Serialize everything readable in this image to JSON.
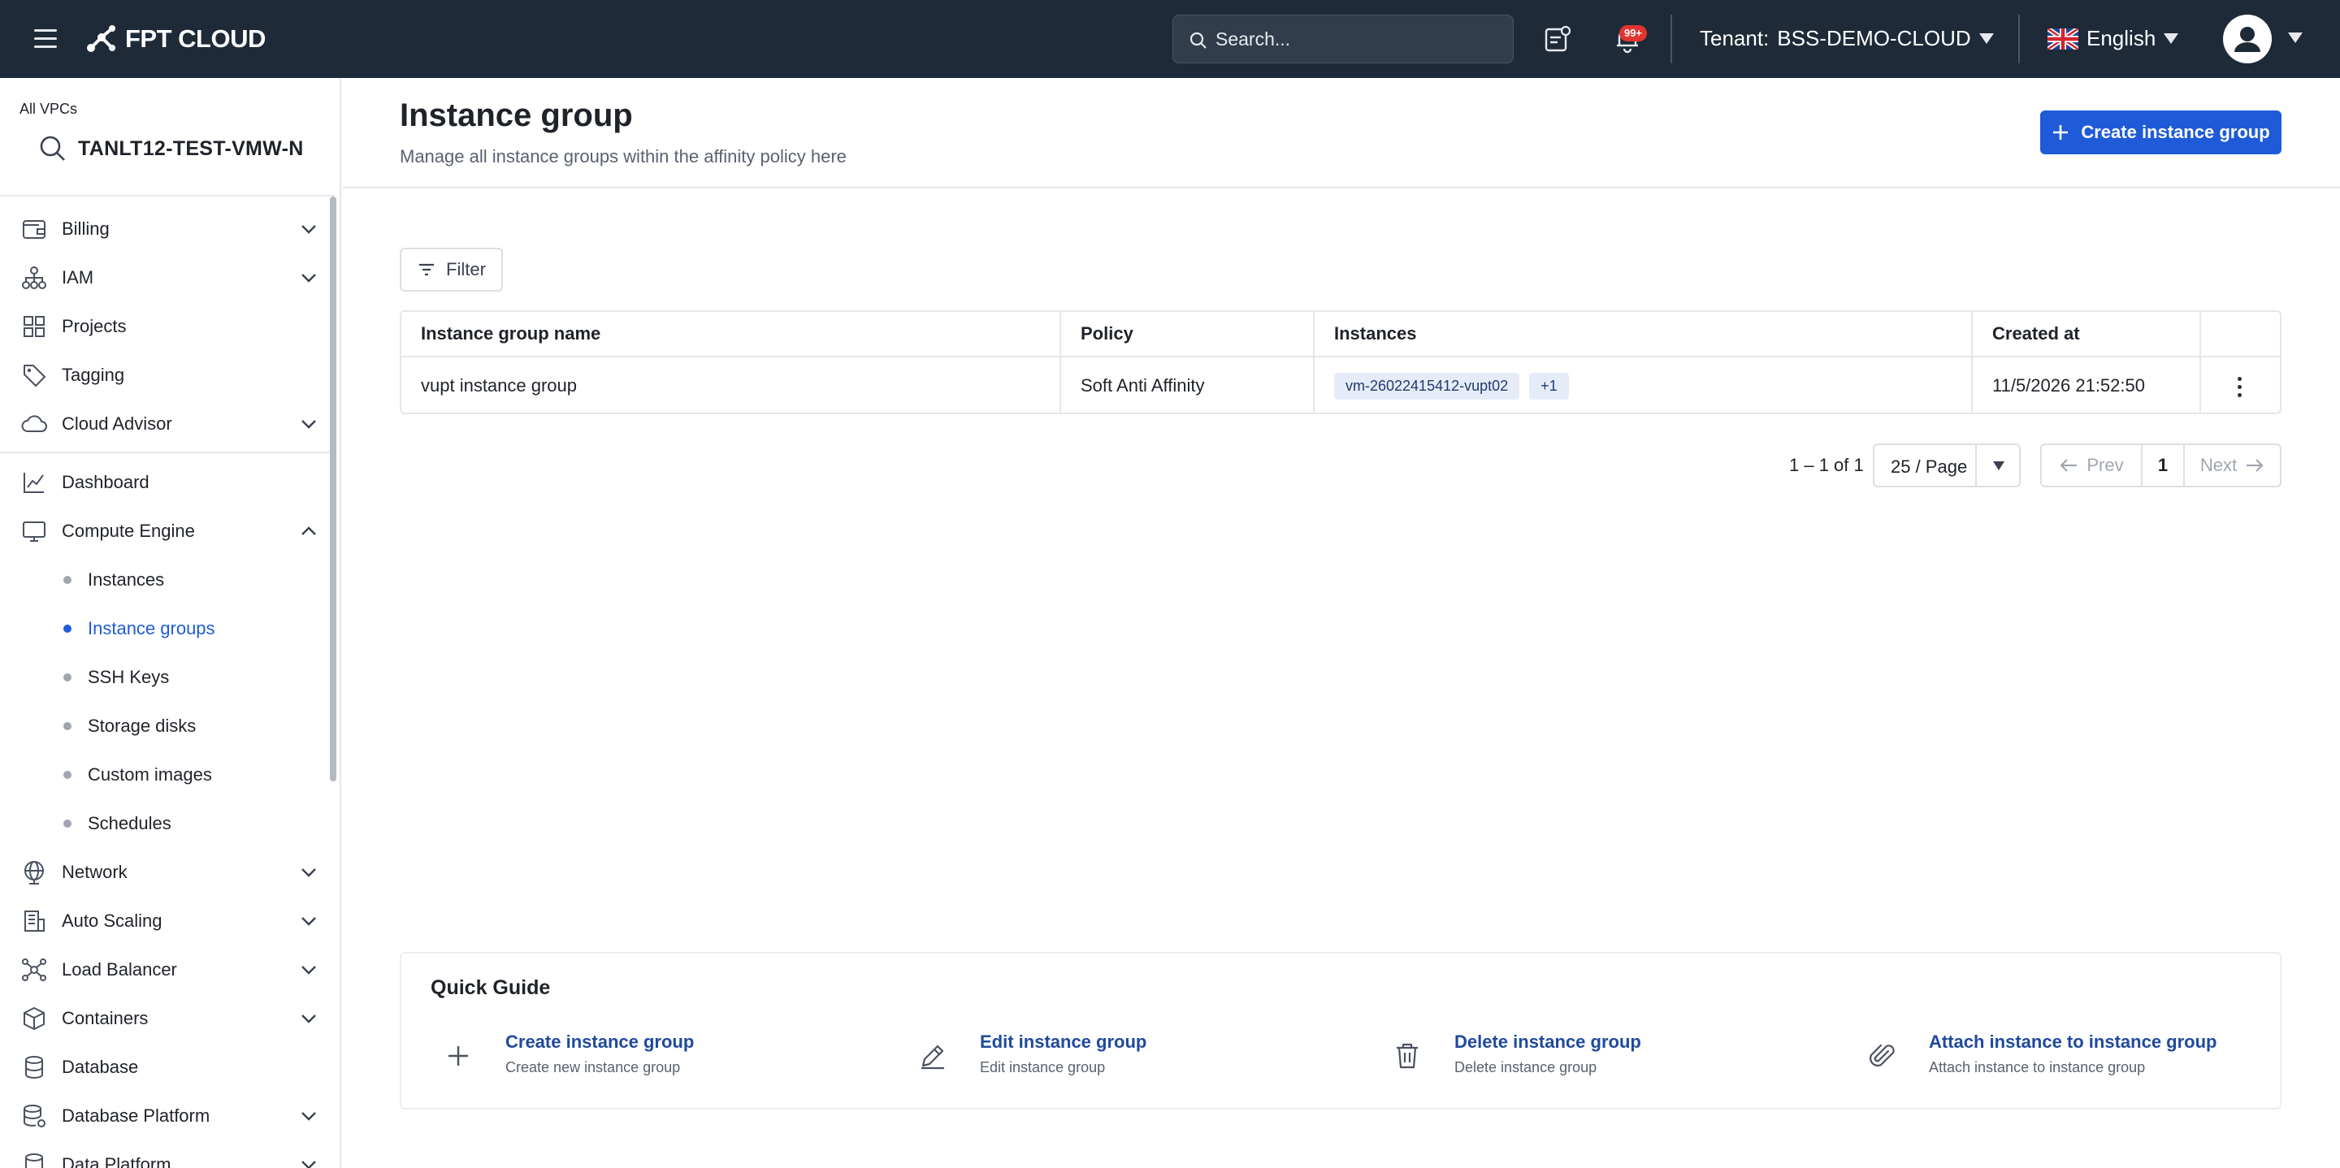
{
  "header": {
    "logo_text": "FPT CLOUD",
    "search_placeholder": "Search...",
    "notification_badge": "99+",
    "tenant_label": "Tenant:",
    "tenant_value": "BSS-DEMO-CLOUD",
    "language": "English"
  },
  "sidebar": {
    "vpc_label": "All VPCs",
    "vpc_name": "TANLT12-TEST-VMW-N",
    "groups": [
      {
        "label": "Billing",
        "icon": "wallet-icon",
        "expandable": true
      },
      {
        "label": "IAM",
        "icon": "hierarchy-icon",
        "expandable": true
      },
      {
        "label": "Projects",
        "icon": "grid-icon",
        "expandable": false
      },
      {
        "label": "Tagging",
        "icon": "tag-icon",
        "expandable": false
      },
      {
        "label": "Cloud Advisor",
        "icon": "cloud-icon",
        "expandable": true
      },
      {
        "label": "Dashboard",
        "icon": "chart-icon",
        "expandable": false
      },
      {
        "label": "Compute Engine",
        "icon": "monitor-icon",
        "expandable": true,
        "expanded": true
      },
      {
        "label": "Network",
        "icon": "globe-icon",
        "expandable": true
      },
      {
        "label": "Auto Scaling",
        "icon": "building-icon",
        "expandable": true
      },
      {
        "label": "Load Balancer",
        "icon": "network-icon",
        "expandable": true
      },
      {
        "label": "Containers",
        "icon": "cube-icon",
        "expandable": true
      },
      {
        "label": "Database",
        "icon": "database-icon",
        "expandable": false
      },
      {
        "label": "Database Platform",
        "icon": "database-platform-icon",
        "expandable": true
      },
      {
        "label": "Data Platform",
        "icon": "data-platform-icon",
        "expandable": true
      }
    ],
    "compute_sub": [
      {
        "label": "Instances",
        "active": false
      },
      {
        "label": "Instance groups",
        "active": true
      },
      {
        "label": "SSH Keys",
        "active": false
      },
      {
        "label": "Storage disks",
        "active": false
      },
      {
        "label": "Custom images",
        "active": false
      },
      {
        "label": "Schedules",
        "active": false
      }
    ]
  },
  "page": {
    "title": "Instance group",
    "subtitle": "Manage all instance groups within the affinity policy here",
    "create_button": "Create instance group",
    "filter_button": "Filter"
  },
  "table": {
    "columns": [
      "Instance group name",
      "Policy",
      "Instances",
      "Created at"
    ],
    "rows": [
      {
        "name": "vupt instance group",
        "policy": "Soft Anti Affinity",
        "instances": [
          "vm-26022415412-vupt02"
        ],
        "instances_more": "+1",
        "created_at": "11/5/2026 21:52:50"
      }
    ]
  },
  "pagination": {
    "info": "1 – 1 of 1",
    "page_size": "25 / Page",
    "prev": "Prev",
    "current": "1",
    "next": "Next"
  },
  "quick_guide": {
    "title": "Quick Guide",
    "items": [
      {
        "title": "Create instance group",
        "subtitle": "Create new instance group",
        "icon": "plus-icon"
      },
      {
        "title": "Edit instance group",
        "subtitle": "Edit instance group",
        "icon": "pencil-icon"
      },
      {
        "title": "Delete instance group",
        "subtitle": "Delete instance group",
        "icon": "trash-icon"
      },
      {
        "title": "Attach instance to instance group",
        "subtitle": "Attach instance to instance group",
        "icon": "paperclip-icon"
      }
    ]
  },
  "colors": {
    "topbar": "#1e2a38",
    "primary": "#1f5bd9",
    "link": "#1f4a9c"
  }
}
